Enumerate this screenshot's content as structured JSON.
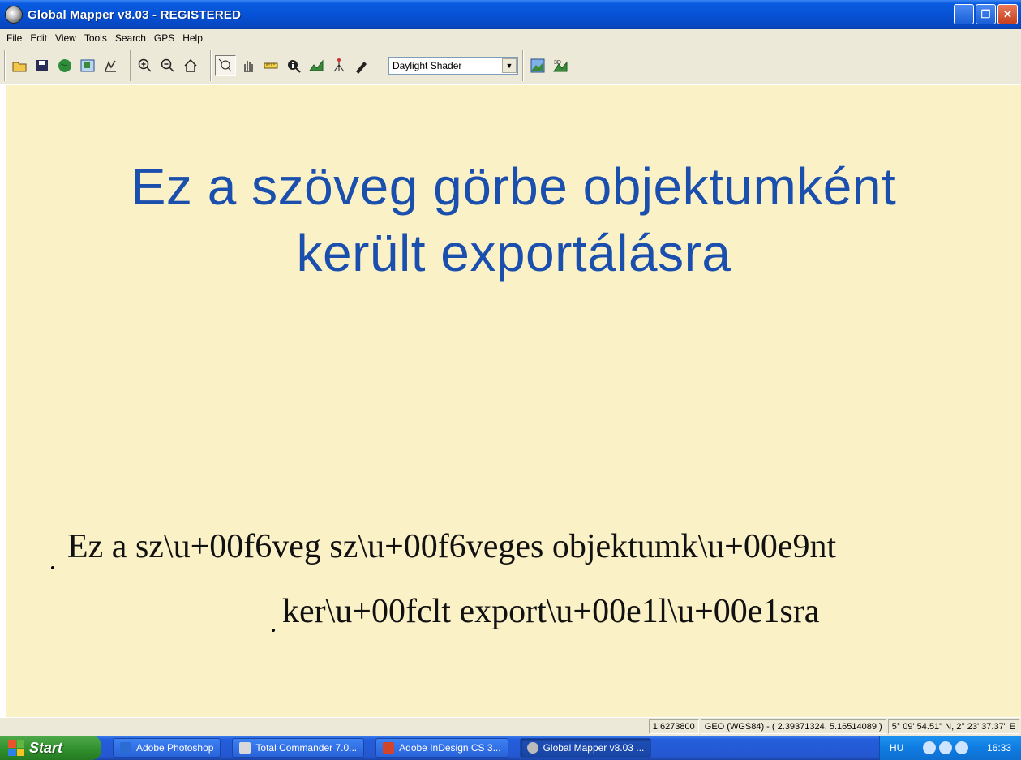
{
  "window": {
    "title": "Global Mapper v8.03 - REGISTERED",
    "controls": {
      "minimize": "_",
      "restore": "❐",
      "close": "✕"
    }
  },
  "menu": {
    "items": [
      "File",
      "Edit",
      "View",
      "Tools",
      "Search",
      "GPS",
      "Help"
    ]
  },
  "toolbar": {
    "file_group": [
      {
        "name": "open-icon",
        "label": "Open"
      },
      {
        "name": "save-icon",
        "label": "Save"
      },
      {
        "name": "globe-icon",
        "label": "Globe"
      },
      {
        "name": "overlay-icon",
        "label": "Overlay"
      },
      {
        "name": "config-icon",
        "label": "Config"
      }
    ],
    "zoom_group": [
      {
        "name": "zoom-in-icon",
        "label": "Zoom In"
      },
      {
        "name": "zoom-out-icon",
        "label": "Zoom Out"
      },
      {
        "name": "home-icon",
        "label": "Home"
      }
    ],
    "tool_group": [
      {
        "name": "zoom-tool-icon",
        "label": "Zoom Tool"
      },
      {
        "name": "pan-hand-icon",
        "label": "Pan"
      },
      {
        "name": "measure-ruler-icon",
        "label": "Measure"
      },
      {
        "name": "feature-info-icon",
        "label": "Feature Info"
      },
      {
        "name": "path-profile-icon",
        "label": "Path Profile"
      },
      {
        "name": "view-shed-icon",
        "label": "View Shed"
      },
      {
        "name": "digitizer-icon",
        "label": "Digitizer"
      }
    ],
    "shader_selected": "Daylight Shader",
    "view_group": [
      {
        "name": "shaded-relief-icon",
        "label": "Shaded Relief"
      },
      {
        "name": "3d-view-icon",
        "label": "3D"
      }
    ]
  },
  "map": {
    "curve_text": [
      "Ez a szöveg görbe objektumként",
      "került exportálásra"
    ],
    "raw_text": [
      "Ez a sz\\u+00f6veg sz\\u+00f6veges objektumk\\u+00e9nt",
      "ker\\u+00fclt export\\u+00e1l\\u+00e1sra"
    ]
  },
  "status": {
    "scale": "1:6273800",
    "projection": "GEO (WGS84) - ( 2.39371324, 5.16514089 )",
    "coordinates": "5° 09' 54.51\" N, 2° 23' 37.37\" E"
  },
  "taskbar": {
    "start_label": "Start",
    "tasks": [
      {
        "label": "Adobe Photoshop",
        "color": "#2b6cd4",
        "active": false
      },
      {
        "label": "Total Commander 7.0...",
        "color": "#d9d9d9",
        "active": false
      },
      {
        "label": "Adobe InDesign CS 3...",
        "color": "#d2452a",
        "active": false
      },
      {
        "label": "Global Mapper v8.03 ...",
        "color": "#bbbbbb",
        "active": true
      }
    ],
    "language": "HU",
    "clock": "16:33"
  },
  "colors": {
    "map_background": "#fbf1c6",
    "curve_text": "#1a4fae",
    "titlebar": "#0652d6"
  }
}
